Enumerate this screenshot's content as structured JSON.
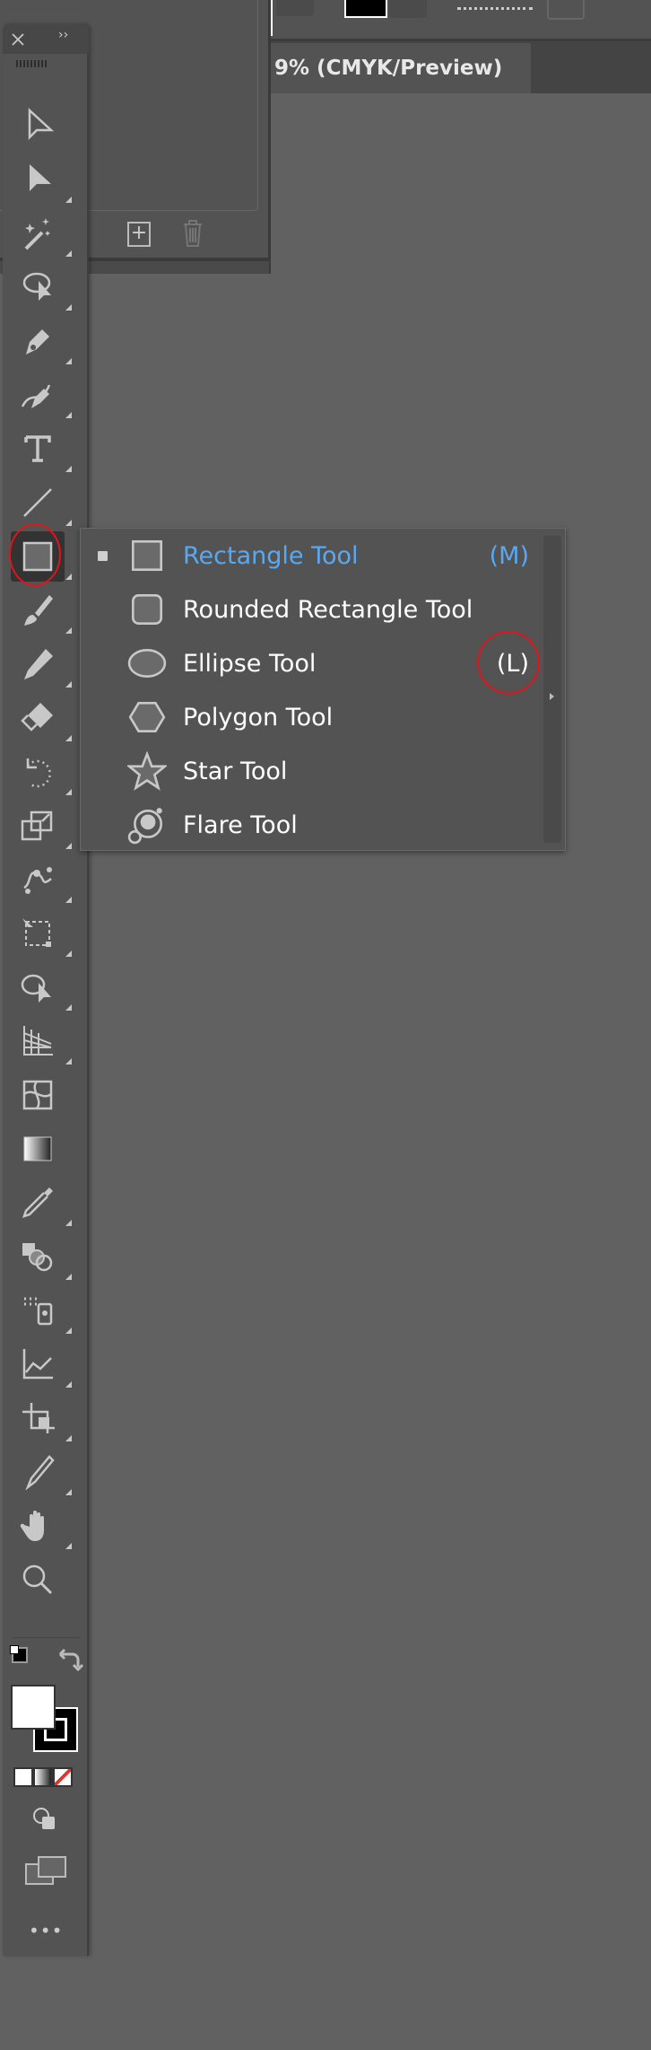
{
  "document_tab": {
    "title": "9% (CMYK/Preview)"
  },
  "toolbar": {
    "close_icon": "close-icon",
    "collapse_icon": "double-chevron-icon",
    "tools": [
      {
        "name": "selection-tool",
        "icon": "arrow-outline",
        "flyout": false
      },
      {
        "name": "direct-selection-tool",
        "icon": "arrow-filled",
        "flyout": true
      },
      {
        "name": "magic-wand-tool",
        "icon": "wand",
        "flyout": true
      },
      {
        "name": "lasso-tool",
        "icon": "lasso",
        "flyout": true
      },
      {
        "name": "pen-tool",
        "icon": "pen",
        "flyout": true
      },
      {
        "name": "curvature-tool",
        "icon": "curvature",
        "flyout": true
      },
      {
        "name": "type-tool",
        "icon": "type",
        "flyout": true
      },
      {
        "name": "line-segment-tool",
        "icon": "line",
        "flyout": true
      },
      {
        "name": "rectangle-tool",
        "icon": "rect",
        "flyout": true,
        "active": true
      },
      {
        "name": "paintbrush-tool",
        "icon": "brush",
        "flyout": true
      },
      {
        "name": "pencil-tool",
        "icon": "pencil",
        "flyout": true
      },
      {
        "name": "eraser-tool",
        "icon": "eraser",
        "flyout": true
      },
      {
        "name": "rotate-tool",
        "icon": "rotate",
        "flyout": true
      },
      {
        "name": "scale-tool",
        "icon": "scale",
        "flyout": true
      },
      {
        "name": "warp-tool",
        "icon": "warp",
        "flyout": true
      },
      {
        "name": "free-transform-tool",
        "icon": "transform",
        "flyout": true
      },
      {
        "name": "shape-builder-tool",
        "icon": "shapebuilder",
        "flyout": true
      },
      {
        "name": "perspective-grid-tool",
        "icon": "perspective",
        "flyout": true
      },
      {
        "name": "mesh-tool",
        "icon": "mesh",
        "flyout": false
      },
      {
        "name": "gradient-tool",
        "icon": "gradient",
        "flyout": false
      },
      {
        "name": "eyedropper-tool",
        "icon": "eyedropper",
        "flyout": true
      },
      {
        "name": "blend-tool",
        "icon": "blend",
        "flyout": true
      },
      {
        "name": "symbol-sprayer-tool",
        "icon": "sprayer",
        "flyout": true
      },
      {
        "name": "column-graph-tool",
        "icon": "graph",
        "flyout": true
      },
      {
        "name": "artboard-tool",
        "icon": "artboard",
        "flyout": true
      },
      {
        "name": "slice-tool",
        "icon": "slice",
        "flyout": true
      },
      {
        "name": "hand-tool",
        "icon": "hand",
        "flyout": true
      },
      {
        "name": "zoom-tool",
        "icon": "zoom",
        "flyout": false
      }
    ],
    "fill_color": "#ffffff",
    "stroke_color": "#000000",
    "none_color": "#e8322b",
    "more_label": "•••"
  },
  "flyout": {
    "items": [
      {
        "label": "Rectangle Tool",
        "shortcut": "(M)",
        "icon": "rect",
        "selected": true
      },
      {
        "label": "Rounded Rectangle Tool",
        "shortcut": "",
        "icon": "roundrect"
      },
      {
        "label": "Ellipse Tool",
        "shortcut": "(L)",
        "icon": "ellipse"
      },
      {
        "label": "Polygon Tool",
        "shortcut": "",
        "icon": "polygon"
      },
      {
        "label": "Star Tool",
        "shortcut": "",
        "icon": "star"
      },
      {
        "label": "Flare Tool",
        "shortcut": "",
        "icon": "flare"
      }
    ]
  },
  "colors": {
    "accent": "#5aa8f0",
    "annotation": "#e0141b",
    "canvas": "#616161",
    "panel": "#535353"
  }
}
